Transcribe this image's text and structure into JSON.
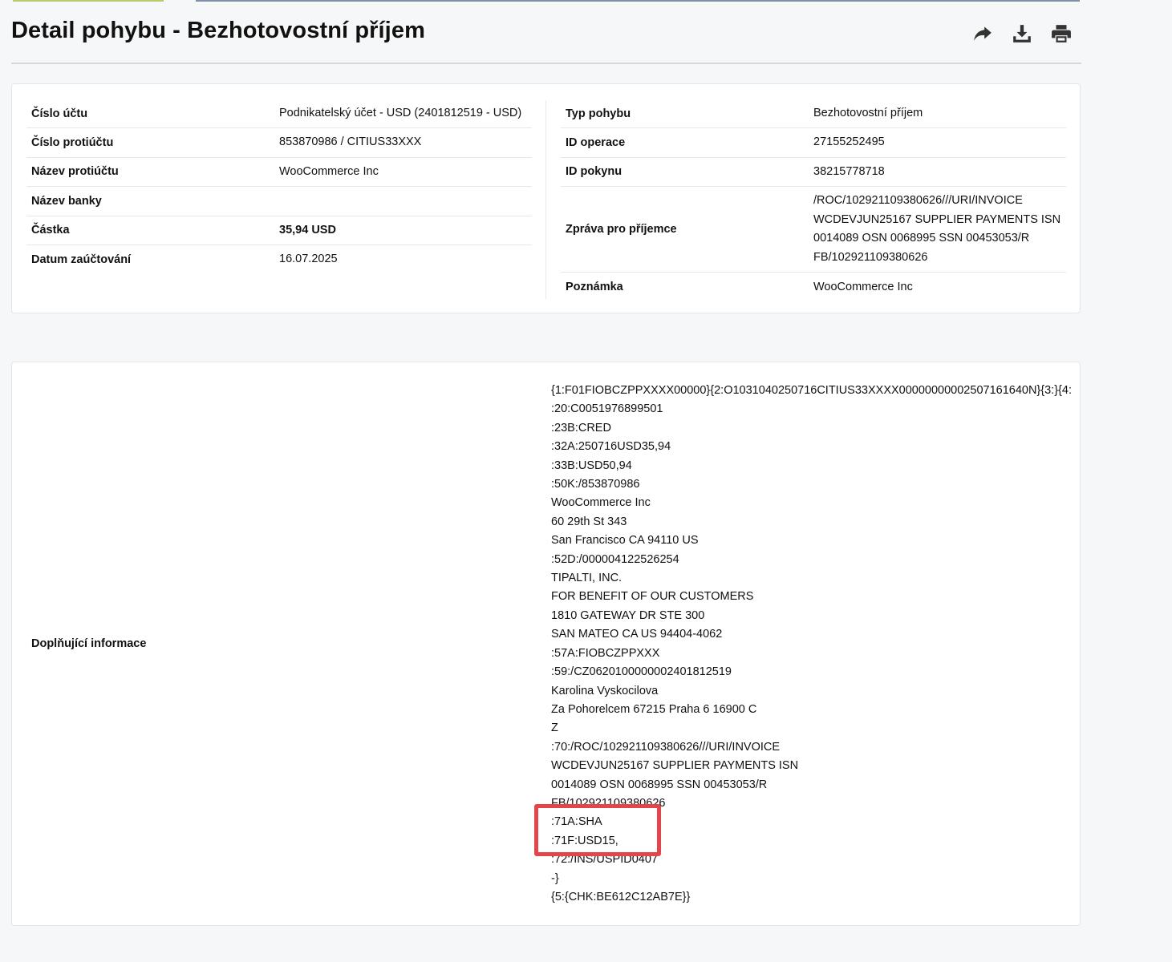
{
  "page": {
    "title": "Detail pohybu - Bezhotovostní příjem",
    "actions": [
      {
        "icon": "share-icon"
      },
      {
        "icon": "download-icon"
      },
      {
        "icon": "print-icon"
      }
    ]
  },
  "details_left": [
    {
      "label": "Číslo účtu",
      "value": "Podnikatelský účet - USD (2401812519 - USD)"
    },
    {
      "label": "Číslo protiúčtu",
      "value": "853870986 / CITIUS33XXX"
    },
    {
      "label": "Název protiúčtu",
      "value": "WooCommerce Inc"
    },
    {
      "label": "Název banky",
      "value": ""
    },
    {
      "label": "Částka",
      "value": "35,94 USD"
    },
    {
      "label": "Datum zaúčtování",
      "value": "16.07.2025"
    }
  ],
  "details_right": [
    {
      "label": "Typ pohybu",
      "value": "Bezhotovostní příjem"
    },
    {
      "label": "ID operace",
      "value": "27155252495"
    },
    {
      "label": "ID pokynu",
      "value": "38215778718"
    },
    {
      "label": "Zpráva pro příjemce",
      "value": "/ROC/102921109380626///URI/INVOICE WCDEVJUN25167 SUPPLIER PAYMENTS ISN 0014089 OSN 0068995 SSN 00453053/R FB/102921109380626"
    },
    {
      "label": "Poznámka",
      "value": "WooCommerce Inc"
    }
  ],
  "extra": {
    "label": "Doplňující informace",
    "lines": [
      "{1:F01FIOBCZPPXXXX00000}{2:O1031040250716CITIUS33XXXX00000000002507161640N}{3:}{4:",
      ":20:C0051976899501",
      ":23B:CRED",
      ":32A:250716USD35,94",
      ":33B:USD50,94",
      ":50K:/853870986",
      "WooCommerce Inc",
      "60 29th St 343",
      "San Francisco CA 94110 US",
      ":52D:/000004122526254",
      "TIPALTI, INC.",
      "FOR BENEFIT OF OUR CUSTOMERS",
      "1810 GATEWAY DR STE 300",
      "SAN MATEO CA US 94404-4062",
      ":57A:FIOBCZPPXXX",
      ":59:/CZ0620100000002401812519",
      "Karolina Vyskocilova",
      "Za Pohorelcem 67215 Praha 6 16900 C",
      "Z",
      ":70:/ROC/102921109380626///URI/INVOICE",
      "WCDEVJUN25167 SUPPLIER PAYMENTS ISN",
      "0014089 OSN 0068995 SSN 00453053/R",
      "FB/102921109380626",
      ":71A:SHA",
      ":71F:USD15,",
      ":72:/INS/USPID0407",
      "-}",
      "{5:{CHK:BE612C12AB7E}}"
    ]
  },
  "colors": {
    "highlight": "#e3454a",
    "accent_green": "#b7c96a",
    "accent_blue": "#7d90a8"
  }
}
